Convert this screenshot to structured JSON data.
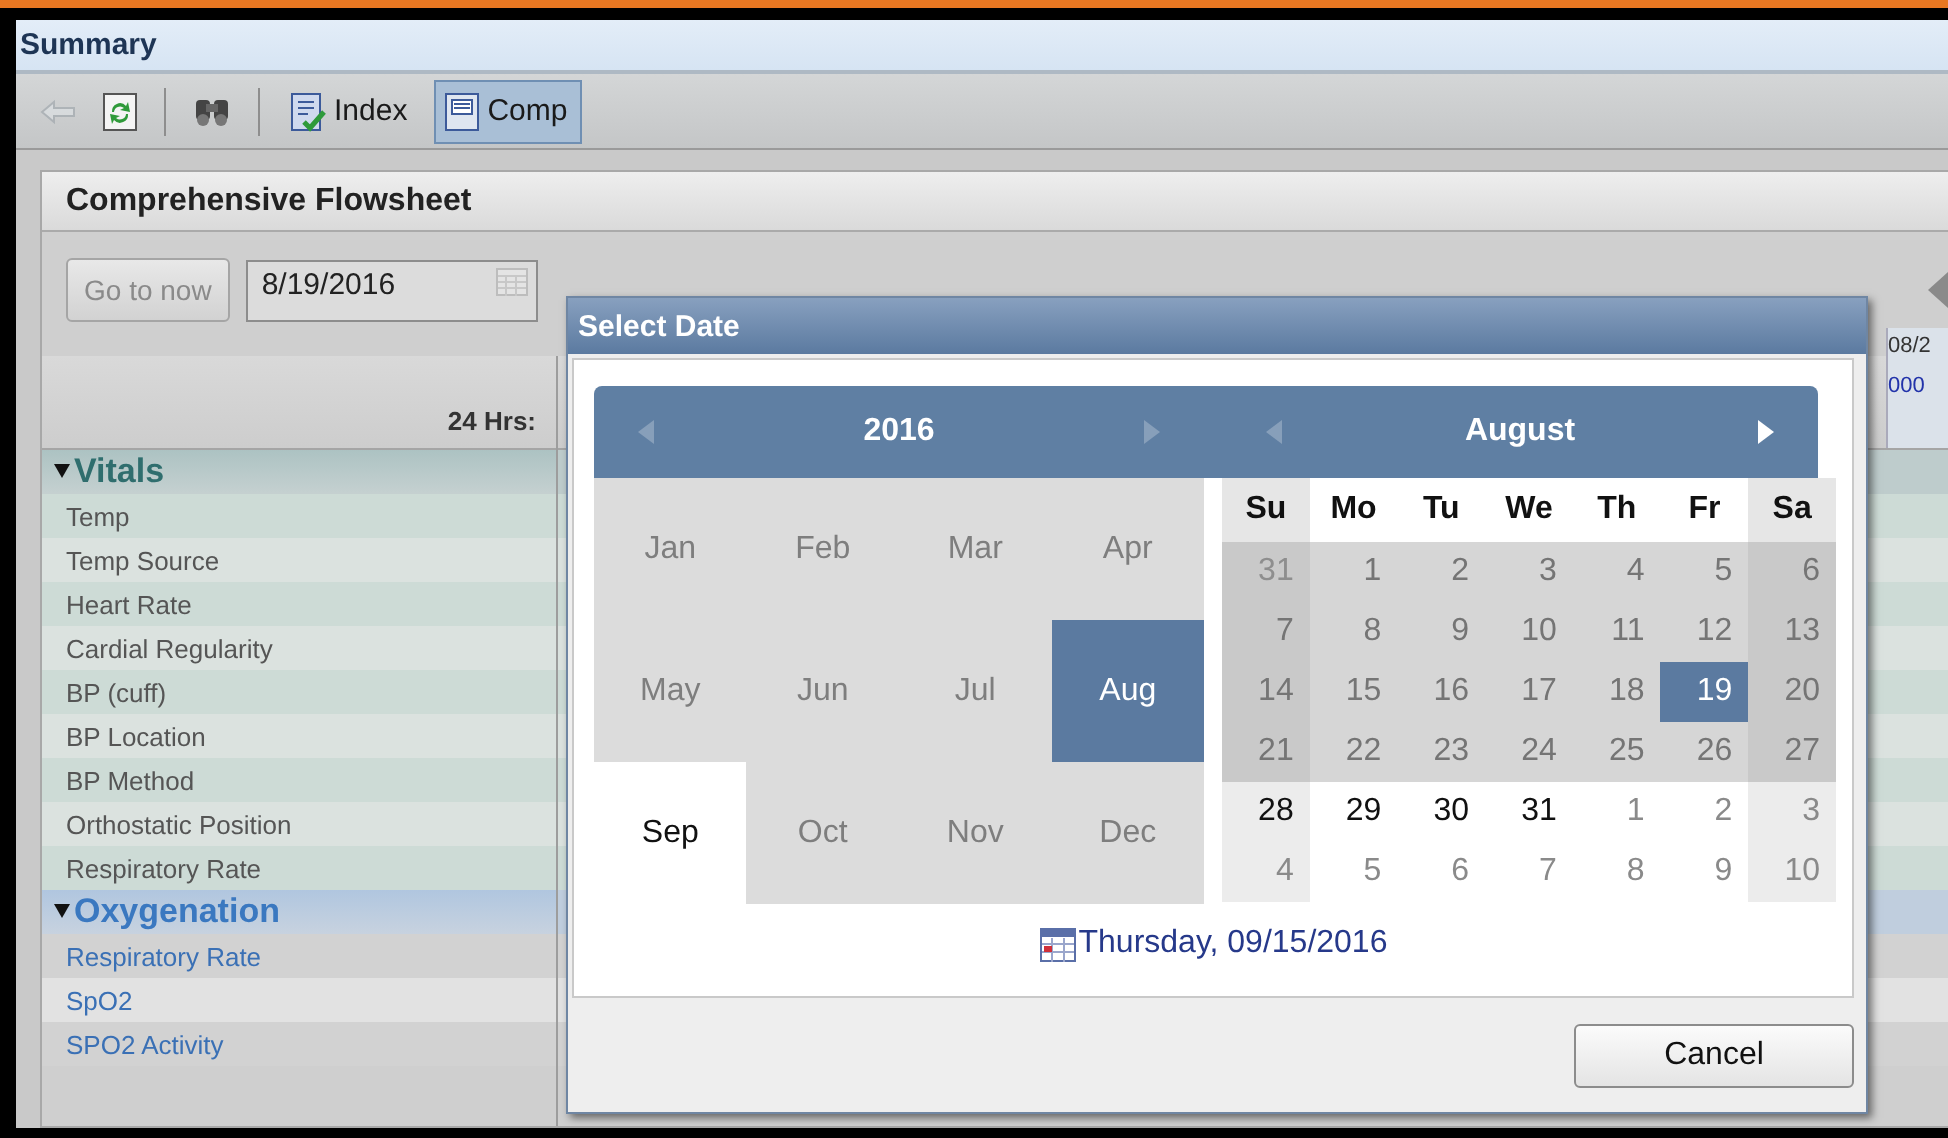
{
  "window": {
    "title": "Summary"
  },
  "toolbar": {
    "items": [
      {
        "kind": "back",
        "disabled": true
      },
      {
        "kind": "refresh",
        "disabled": false
      },
      {
        "kind": "separator"
      },
      {
        "kind": "find",
        "disabled": false
      },
      {
        "kind": "separator"
      },
      {
        "kind": "tab",
        "label": "Index",
        "selected": false
      },
      {
        "kind": "tab",
        "label": "Comp",
        "selected": true
      }
    ]
  },
  "flowsheet": {
    "title": "Comprehensive Flowsheet",
    "go_to_now": {
      "label": "Go to now",
      "disabled": true
    },
    "date_field": {
      "value": "8/19/2016"
    },
    "range_label": "24 Hrs:",
    "column_3": {
      "date": "08/2",
      "time": "000"
    },
    "groups": [
      {
        "label": "Vitals",
        "expanded": true,
        "color": "#2f6e6e",
        "kind": "plain",
        "rows": [
          "Temp",
          "Temp Source",
          "Heart Rate",
          "Cardial Regularity",
          "BP (cuff)",
          "BP Location",
          "BP Method",
          "Orthostatic Position",
          "Respiratory Rate"
        ]
      },
      {
        "label": "Oxygenation",
        "expanded": true,
        "color": "#3a78c0",
        "kind": "link",
        "rows": [
          "Respiratory Rate",
          "SpO2",
          "SPO2 Activity"
        ]
      }
    ]
  },
  "dialog": {
    "title": "Select Date",
    "year": {
      "label": "2016",
      "prev_disabled": true,
      "next_disabled": true
    },
    "month": {
      "label": "August",
      "prev_disabled": true,
      "next_disabled": false
    },
    "months": [
      {
        "label": "Jan",
        "selected": false,
        "current": false
      },
      {
        "label": "Feb",
        "selected": false,
        "current": false
      },
      {
        "label": "Mar",
        "selected": false,
        "current": false
      },
      {
        "label": "Apr",
        "selected": false,
        "current": false
      },
      {
        "label": "May",
        "selected": false,
        "current": false
      },
      {
        "label": "Jun",
        "selected": false,
        "current": false
      },
      {
        "label": "Jul",
        "selected": false,
        "current": false
      },
      {
        "label": "Aug",
        "selected": true,
        "current": false
      },
      {
        "label": "Sep",
        "selected": false,
        "current": true
      },
      {
        "label": "Oct",
        "selected": false,
        "current": false
      },
      {
        "label": "Nov",
        "selected": false,
        "current": false
      },
      {
        "label": "Dec",
        "selected": false,
        "current": false
      }
    ],
    "weekdays": [
      {
        "label": "Su",
        "weekend": true
      },
      {
        "label": "Mo",
        "weekend": false
      },
      {
        "label": "Tu",
        "weekend": false
      },
      {
        "label": "We",
        "weekend": false
      },
      {
        "label": "Th",
        "weekend": false
      },
      {
        "label": "Fr",
        "weekend": false
      },
      {
        "label": "Sa",
        "weekend": true
      }
    ],
    "weeks": [
      {
        "shaded": true,
        "days": [
          {
            "label": "31",
            "outside": true,
            "selected": false
          },
          {
            "label": "1",
            "outside": false,
            "selected": false
          },
          {
            "label": "2",
            "outside": false,
            "selected": false
          },
          {
            "label": "3",
            "outside": false,
            "selected": false
          },
          {
            "label": "4",
            "outside": false,
            "selected": false
          },
          {
            "label": "5",
            "outside": false,
            "selected": false
          },
          {
            "label": "6",
            "outside": false,
            "selected": false
          }
        ]
      },
      {
        "shaded": true,
        "days": [
          {
            "label": "7",
            "outside": false,
            "selected": false
          },
          {
            "label": "8",
            "outside": false,
            "selected": false
          },
          {
            "label": "9",
            "outside": false,
            "selected": false
          },
          {
            "label": "10",
            "outside": false,
            "selected": false
          },
          {
            "label": "11",
            "outside": false,
            "selected": false
          },
          {
            "label": "12",
            "outside": false,
            "selected": false
          },
          {
            "label": "13",
            "outside": false,
            "selected": false
          }
        ]
      },
      {
        "shaded": true,
        "days": [
          {
            "label": "14",
            "outside": false,
            "selected": false
          },
          {
            "label": "15",
            "outside": false,
            "selected": false
          },
          {
            "label": "16",
            "outside": false,
            "selected": false
          },
          {
            "label": "17",
            "outside": false,
            "selected": false
          },
          {
            "label": "18",
            "outside": false,
            "selected": false
          },
          {
            "label": "19",
            "outside": false,
            "selected": true
          },
          {
            "label": "20",
            "outside": false,
            "selected": false
          }
        ]
      },
      {
        "shaded": true,
        "days": [
          {
            "label": "21",
            "outside": false,
            "selected": false
          },
          {
            "label": "22",
            "outside": false,
            "selected": false
          },
          {
            "label": "23",
            "outside": false,
            "selected": false
          },
          {
            "label": "24",
            "outside": false,
            "selected": false
          },
          {
            "label": "25",
            "outside": false,
            "selected": false
          },
          {
            "label": "26",
            "outside": false,
            "selected": false
          },
          {
            "label": "27",
            "outside": false,
            "selected": false
          }
        ]
      },
      {
        "shaded": false,
        "days": [
          {
            "label": "28",
            "outside": false,
            "selected": false
          },
          {
            "label": "29",
            "outside": false,
            "selected": false
          },
          {
            "label": "30",
            "outside": false,
            "selected": false
          },
          {
            "label": "31",
            "outside": false,
            "selected": false
          },
          {
            "label": "1",
            "outside": true,
            "selected": false
          },
          {
            "label": "2",
            "outside": true,
            "selected": false
          },
          {
            "label": "3",
            "outside": true,
            "selected": false
          }
        ]
      },
      {
        "shaded": false,
        "days": [
          {
            "label": "4",
            "outside": true,
            "selected": false
          },
          {
            "label": "5",
            "outside": true,
            "selected": false
          },
          {
            "label": "6",
            "outside": true,
            "selected": false
          },
          {
            "label": "7",
            "outside": true,
            "selected": false
          },
          {
            "label": "8",
            "outside": true,
            "selected": false
          },
          {
            "label": "9",
            "outside": true,
            "selected": false
          },
          {
            "label": "10",
            "outside": true,
            "selected": false
          }
        ]
      }
    ],
    "today_link": "Thursday, 09/15/2016",
    "cancel": "Cancel"
  }
}
